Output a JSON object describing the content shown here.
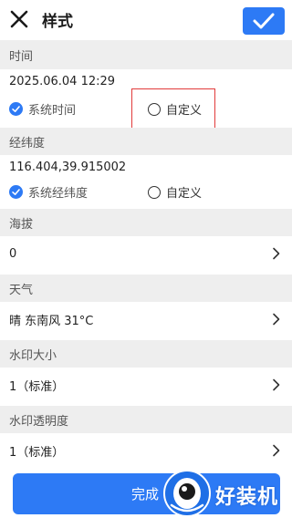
{
  "header": {
    "title": "样式",
    "close_icon": "close-icon",
    "confirm_icon": "check-icon"
  },
  "time": {
    "section_label": "时间",
    "value": "2025.06.04 12:29",
    "option_system": "系统时间",
    "option_custom": "自定义",
    "selected": "system"
  },
  "latlng": {
    "section_label": "经纬度",
    "value": "116.404,39.915002",
    "option_system": "系统经纬度",
    "option_custom": "自定义",
    "selected": "system"
  },
  "altitude": {
    "section_label": "海拔",
    "value": "0"
  },
  "weather": {
    "section_label": "天气",
    "value": "晴 东南风 31°C"
  },
  "watermark_size": {
    "section_label": "水印大小",
    "value": "1（标准）"
  },
  "watermark_opacity": {
    "section_label": "水印透明度",
    "value": "1（标准）"
  },
  "footer": {
    "done_label": "完成",
    "watermark_text": "好装机"
  },
  "colors": {
    "accent": "#2d7af5",
    "highlight": "#e23a3a",
    "section_bg": "#eeeeee"
  }
}
